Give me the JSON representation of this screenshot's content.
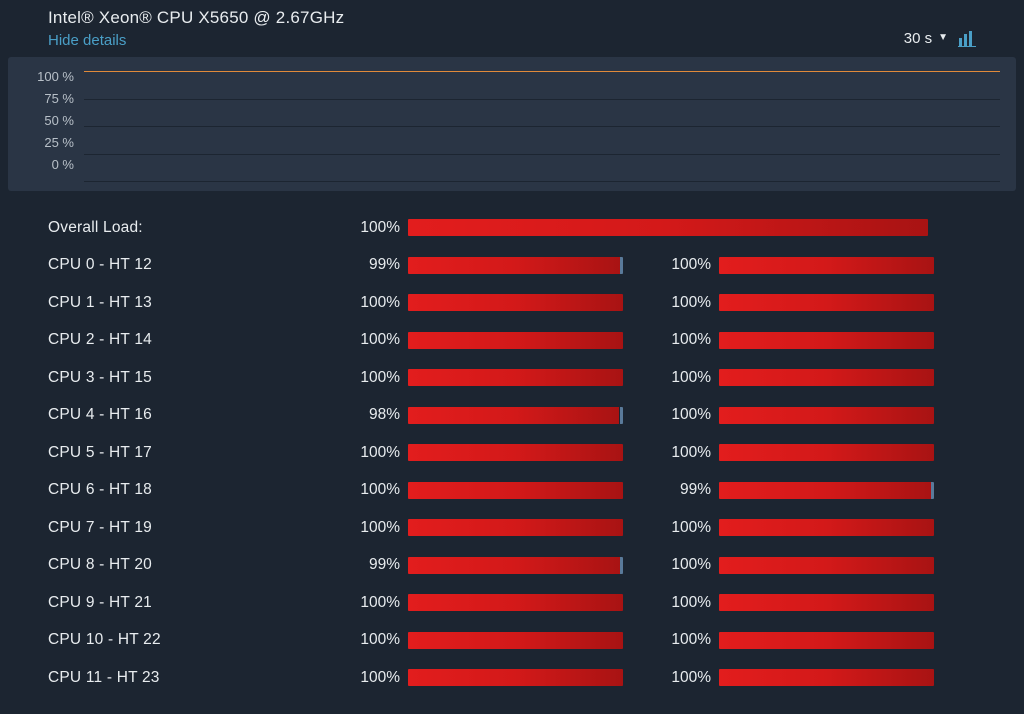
{
  "header": {
    "title": "Intel® Xeon® CPU X5650 @ 2.67GHz",
    "hide_details": "Hide details",
    "time_range": "30 s",
    "triangle": "▼"
  },
  "graph": {
    "yticks": [
      "100 %",
      "75 %",
      "50 %",
      "25 %",
      "0 %"
    ],
    "line_at_pct": 100
  },
  "overall": {
    "label": "Overall Load:",
    "pct": 100,
    "pct_text": "100%"
  },
  "cores": [
    {
      "label": "CPU 0 - HT 12",
      "a_pct": 99,
      "a_text": "99%",
      "b_pct": 100,
      "b_text": "100%"
    },
    {
      "label": "CPU 1 - HT 13",
      "a_pct": 100,
      "a_text": "100%",
      "b_pct": 100,
      "b_text": "100%"
    },
    {
      "label": "CPU 2 - HT 14",
      "a_pct": 100,
      "a_text": "100%",
      "b_pct": 100,
      "b_text": "100%"
    },
    {
      "label": "CPU 3 - HT 15",
      "a_pct": 100,
      "a_text": "100%",
      "b_pct": 100,
      "b_text": "100%"
    },
    {
      "label": "CPU 4 - HT 16",
      "a_pct": 98,
      "a_text": "98%",
      "b_pct": 100,
      "b_text": "100%"
    },
    {
      "label": "CPU 5 - HT 17",
      "a_pct": 100,
      "a_text": "100%",
      "b_pct": 100,
      "b_text": "100%"
    },
    {
      "label": "CPU 6 - HT 18",
      "a_pct": 100,
      "a_text": "100%",
      "b_pct": 99,
      "b_text": "99%"
    },
    {
      "label": "CPU 7 - HT 19",
      "a_pct": 100,
      "a_text": "100%",
      "b_pct": 100,
      "b_text": "100%"
    },
    {
      "label": "CPU 8 - HT 20",
      "a_pct": 99,
      "a_text": "99%",
      "b_pct": 100,
      "b_text": "100%"
    },
    {
      "label": "CPU 9 - HT 21",
      "a_pct": 100,
      "a_text": "100%",
      "b_pct": 100,
      "b_text": "100%"
    },
    {
      "label": "CPU 10 - HT 22",
      "a_pct": 100,
      "a_text": "100%",
      "b_pct": 100,
      "b_text": "100%"
    },
    {
      "label": "CPU 11 - HT 23",
      "a_pct": 100,
      "a_text": "100%",
      "b_pct": 100,
      "b_text": "100%"
    }
  ]
}
